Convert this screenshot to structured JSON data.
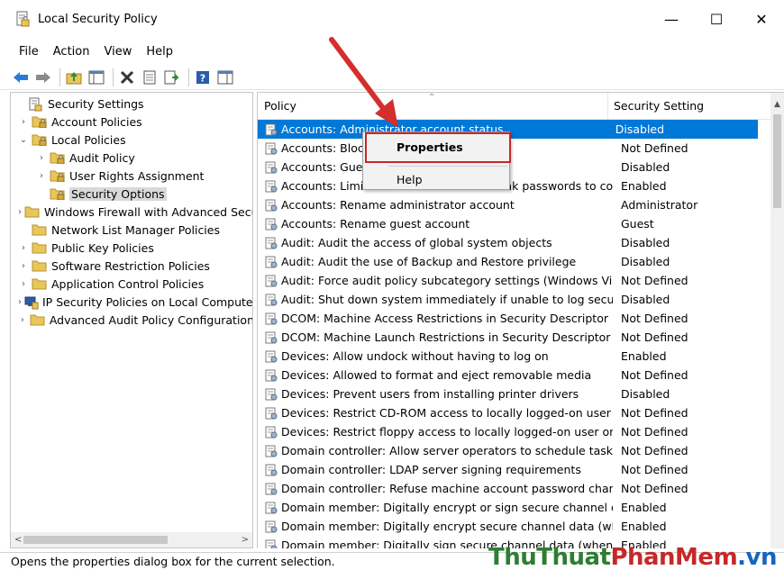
{
  "window": {
    "title": "Local Security Policy",
    "minimize": "—",
    "maximize": "☐",
    "close": "✕"
  },
  "menu": [
    "File",
    "Action",
    "View",
    "Help"
  ],
  "tree": [
    {
      "label": "Security Settings",
      "level": 0,
      "arrow": "",
      "selected": false,
      "icon": "security-settings-icon"
    },
    {
      "label": "Account Policies",
      "level": 1,
      "arrow": "›",
      "selected": false,
      "icon": "folder-lock-icon"
    },
    {
      "label": "Local Policies",
      "level": 1,
      "arrow": "⌄",
      "selected": false,
      "icon": "folder-lock-icon"
    },
    {
      "label": "Audit Policy",
      "level": 2,
      "arrow": "›",
      "selected": false,
      "icon": "folder-lock-icon"
    },
    {
      "label": "User Rights Assignment",
      "level": 2,
      "arrow": "›",
      "selected": false,
      "icon": "folder-lock-icon"
    },
    {
      "label": "Security Options",
      "level": 2,
      "arrow": "",
      "selected": true,
      "icon": "folder-lock-icon"
    },
    {
      "label": "Windows Firewall with Advanced Security",
      "level": 1,
      "arrow": "›",
      "selected": false,
      "icon": "folder-icon"
    },
    {
      "label": "Network List Manager Policies",
      "level": 1,
      "arrow": "",
      "selected": false,
      "icon": "folder-icon"
    },
    {
      "label": "Public Key Policies",
      "level": 1,
      "arrow": "›",
      "selected": false,
      "icon": "folder-icon"
    },
    {
      "label": "Software Restriction Policies",
      "level": 1,
      "arrow": "›",
      "selected": false,
      "icon": "folder-icon"
    },
    {
      "label": "Application Control Policies",
      "level": 1,
      "arrow": "›",
      "selected": false,
      "icon": "folder-icon"
    },
    {
      "label": "IP Security Policies on Local Computer",
      "level": 1,
      "arrow": "›",
      "selected": false,
      "icon": "ip-security-icon"
    },
    {
      "label": "Advanced Audit Policy Configuration",
      "level": 1,
      "arrow": "›",
      "selected": false,
      "icon": "folder-icon"
    }
  ],
  "list": {
    "col_policy": "Policy",
    "col_setting": "Security Setting",
    "rows": [
      {
        "policy": "Accounts: Administrator account status",
        "setting": "Disabled",
        "selected": true
      },
      {
        "policy": "Accounts: Block Microsoft accounts",
        "setting": "Not Defined",
        "selected": false
      },
      {
        "policy": "Accounts: Guest account status",
        "setting": "Disabled",
        "selected": false
      },
      {
        "policy": "Accounts: Limit local account use of blank passwords to co...",
        "setting": "Enabled",
        "selected": false
      },
      {
        "policy": "Accounts: Rename administrator account",
        "setting": "Administrator",
        "selected": false
      },
      {
        "policy": "Accounts: Rename guest account",
        "setting": "Guest",
        "selected": false
      },
      {
        "policy": "Audit: Audit the access of global system objects",
        "setting": "Disabled",
        "selected": false
      },
      {
        "policy": "Audit: Audit the use of Backup and Restore privilege",
        "setting": "Disabled",
        "selected": false
      },
      {
        "policy": "Audit: Force audit policy subcategory settings (Windows Vis...",
        "setting": "Not Defined",
        "selected": false
      },
      {
        "policy": "Audit: Shut down system immediately if unable to log secur...",
        "setting": "Disabled",
        "selected": false
      },
      {
        "policy": "DCOM: Machine Access Restrictions in Security Descriptor D...",
        "setting": "Not Defined",
        "selected": false
      },
      {
        "policy": "DCOM: Machine Launch Restrictions in Security Descriptor ...",
        "setting": "Not Defined",
        "selected": false
      },
      {
        "policy": "Devices: Allow undock without having to log on",
        "setting": "Enabled",
        "selected": false
      },
      {
        "policy": "Devices: Allowed to format and eject removable media",
        "setting": "Not Defined",
        "selected": false
      },
      {
        "policy": "Devices: Prevent users from installing printer drivers",
        "setting": "Disabled",
        "selected": false
      },
      {
        "policy": "Devices: Restrict CD-ROM access to locally logged-on user ...",
        "setting": "Not Defined",
        "selected": false
      },
      {
        "policy": "Devices: Restrict floppy access to locally logged-on user only",
        "setting": "Not Defined",
        "selected": false
      },
      {
        "policy": "Domain controller: Allow server operators to schedule tasks",
        "setting": "Not Defined",
        "selected": false
      },
      {
        "policy": "Domain controller: LDAP server signing requirements",
        "setting": "Not Defined",
        "selected": false
      },
      {
        "policy": "Domain controller: Refuse machine account password chan...",
        "setting": "Not Defined",
        "selected": false
      },
      {
        "policy": "Domain member: Digitally encrypt or sign secure channel d...",
        "setting": "Enabled",
        "selected": false
      },
      {
        "policy": "Domain member: Digitally encrypt secure channel data (wh...",
        "setting": "Enabled",
        "selected": false
      },
      {
        "policy": "Domain member: Digitally sign secure channel data (when ...",
        "setting": "Enabled",
        "selected": false
      }
    ]
  },
  "context_menu": {
    "properties": "Properties",
    "help": "Help"
  },
  "status": "Opens the properties dialog box for the current selection.",
  "watermark": {
    "part1": "ThuThuat",
    "part2": "PhanMem",
    "part3": ".vn"
  },
  "colors": {
    "selection": "#0078d7",
    "highlight_box": "#c62828",
    "folder": "#e8c65a"
  }
}
